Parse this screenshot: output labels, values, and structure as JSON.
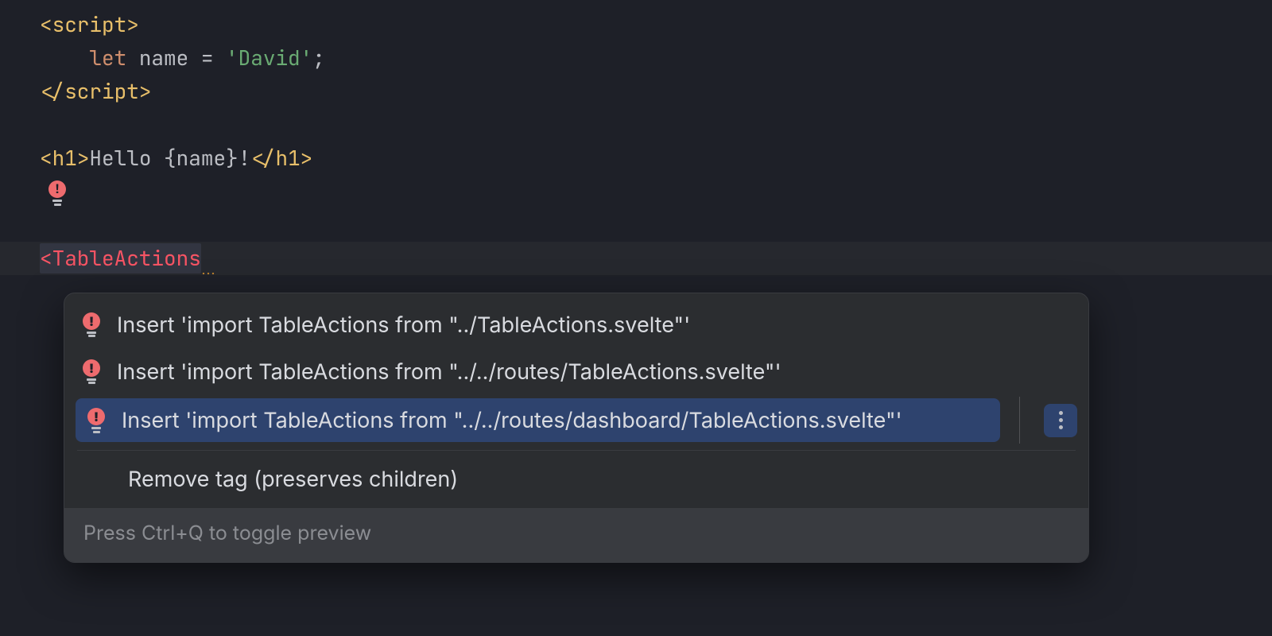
{
  "code": {
    "script_open_lt": "<",
    "script_open_name": "script",
    "script_open_gt": ">",
    "indent": "    ",
    "let_kw": "let",
    "name_ident": "name",
    "eq": " = ",
    "str_open": "'",
    "str_val": "David",
    "str_close": "'",
    "semicolon": ";",
    "script_close_lt": "</",
    "script_close_name": "script",
    "script_close_gt": ">",
    "h1_open_lt": "<",
    "h1_open_name": "h1",
    "h1_open_gt": ">",
    "hello_text": "Hello ",
    "lb": "{",
    "expr": "name",
    "rb": "}",
    "excl": "!",
    "h1_close_lt": "</",
    "h1_close_name": "h1",
    "h1_close_gt": ">",
    "lt": "<",
    "component": "TableActions",
    "bulb_glyph": "!"
  },
  "popup": {
    "items": [
      "Insert 'import TableActions from \"../TableActions.svelte\"'",
      "Insert 'import TableActions from \"../../routes/TableActions.svelte\"'",
      "Insert 'import TableActions from \"../../routes/dashboard/TableActions.svelte\"'"
    ],
    "remove_tag": "Remove tag (preserves children)",
    "footer_hint": "Press Ctrl+Q to toggle preview"
  }
}
